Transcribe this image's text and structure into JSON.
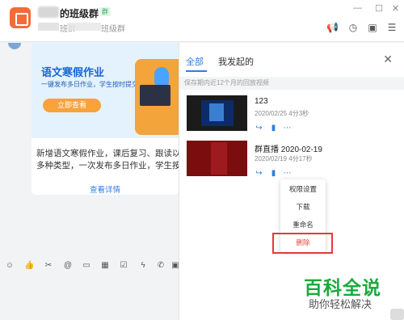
{
  "titlebar": {
    "group_name": "的班级群",
    "group_tag": "群",
    "sub_text": "班群",
    "sub_text_tail": "班级群"
  },
  "chat_card": {
    "banner_title": "语文寒假作业",
    "banner_subtitle": "一键发布多日作业，学生按时提交",
    "banner_button": "立即查看",
    "body_line1": "新增语文寒假作业，课后复习、跟读以及背",
    "body_line2": "多种类型，一次发布多日作业，学生按时提",
    "detail_link": "查看详情"
  },
  "panel": {
    "tabs": [
      "全部",
      "我发起的"
    ],
    "notice": "保存期内近12个月的回放视频",
    "recordings": [
      {
        "title": "123",
        "meta": "2020/02/25 4分3秒"
      },
      {
        "title": "群直播 2020-02-19",
        "meta": "2020/02/19 4分17秒"
      }
    ]
  },
  "context_menu": {
    "items": [
      "权限设置",
      "下载",
      "重命名",
      "删除"
    ]
  },
  "watermark": {
    "title": "百科全说",
    "subtitle": "助你轻松解决"
  },
  "colors": {
    "accent": "#2f7de1",
    "danger": "#e54545",
    "brand_green": "#1aaa3c"
  }
}
